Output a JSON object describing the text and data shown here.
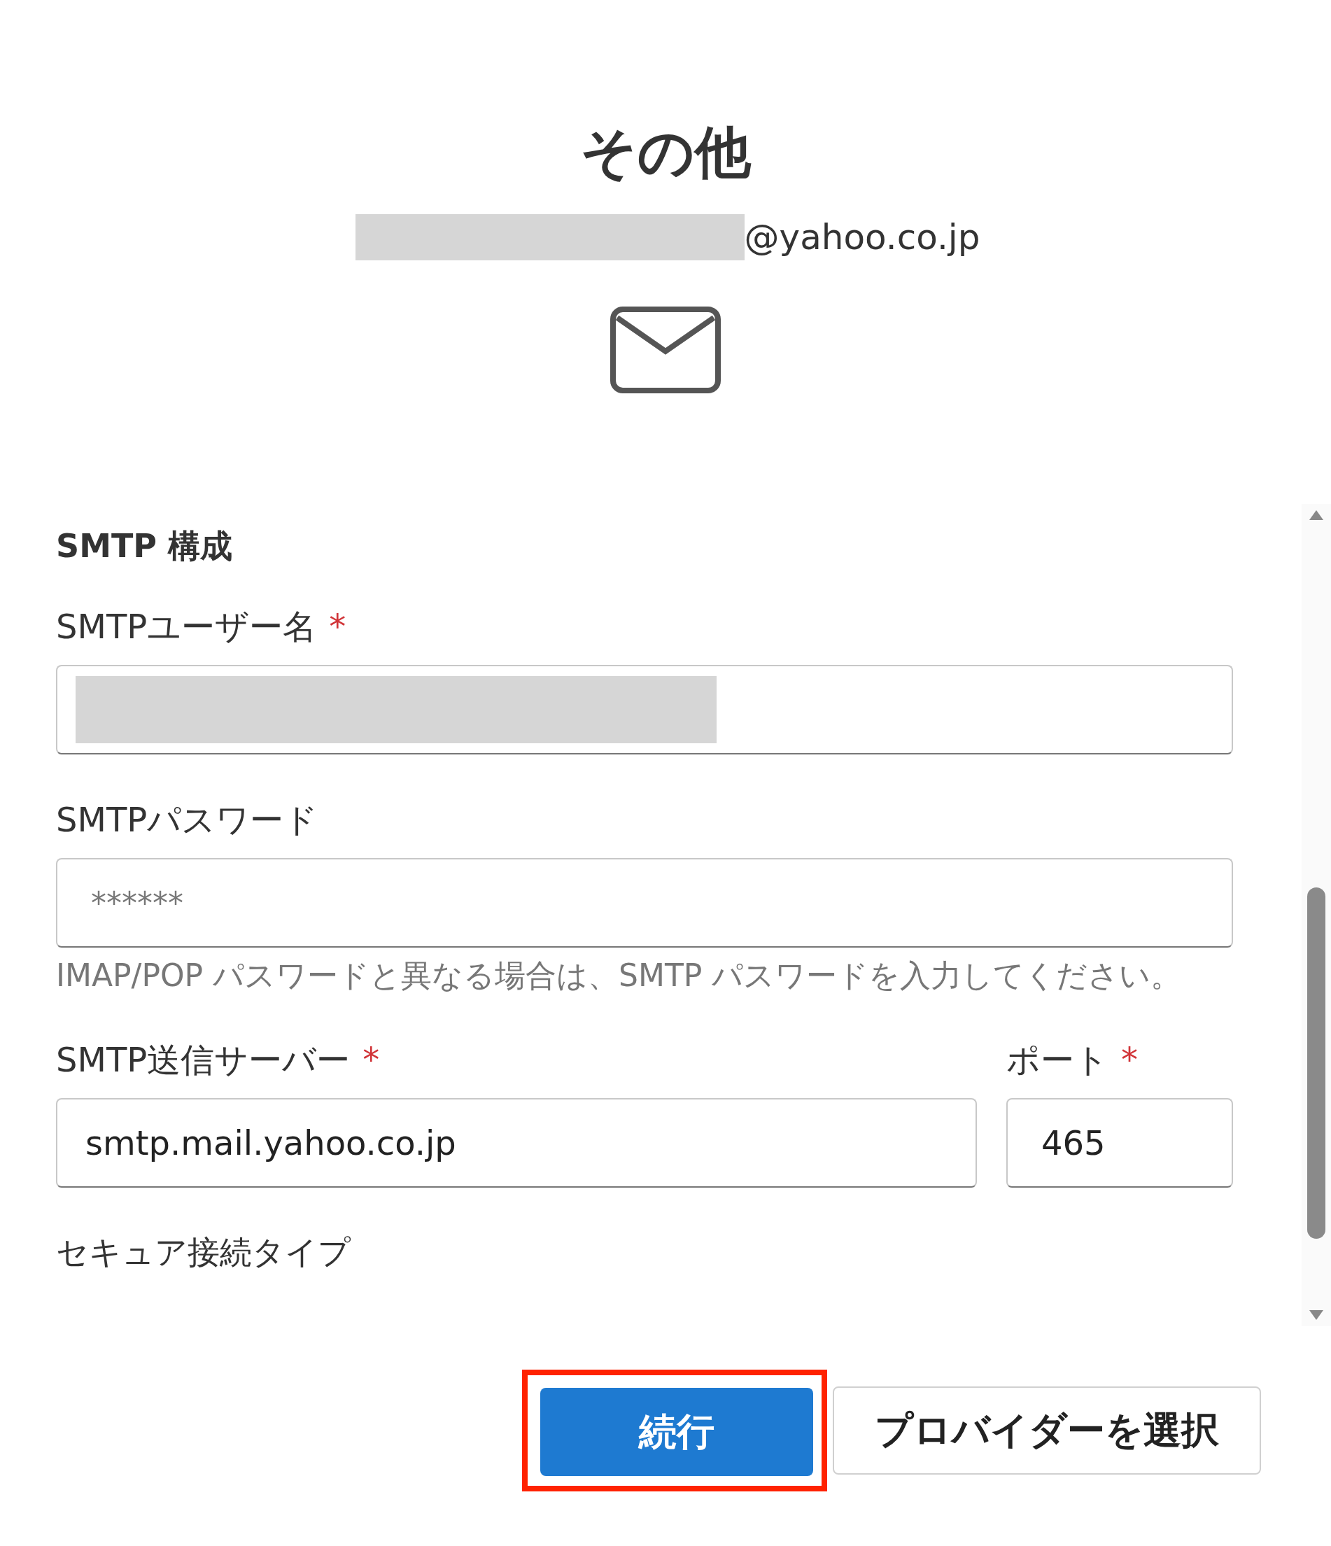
{
  "title": "その他",
  "account": {
    "redacted": true,
    "domain": "@yahoo.co.jp"
  },
  "section": {
    "heading": "SMTP 構成"
  },
  "fields": [
    {
      "label": "SMTPユーザー名",
      "required_mark": "*",
      "redacted": true
    },
    {
      "label": "SMTPパスワード",
      "placeholder": "******",
      "help": "IMAP/POP パスワードと異なる場合は、SMTP パスワードを入力してください。"
    }
  ],
  "server_row": [
    {
      "label": "SMTP送信サーバー",
      "required_mark": "*",
      "value": "smtp.mail.yahoo.co.jp"
    },
    {
      "label": "ポート",
      "required_mark": "*",
      "value": "465"
    }
  ],
  "cut_label": "セキュア接続タイプ",
  "buttons": [
    {
      "label": "続行",
      "kind": "primary",
      "highlighted": true
    },
    {
      "label": "プロバイダーを選択",
      "kind": "secondary",
      "highlighted": false
    }
  ]
}
